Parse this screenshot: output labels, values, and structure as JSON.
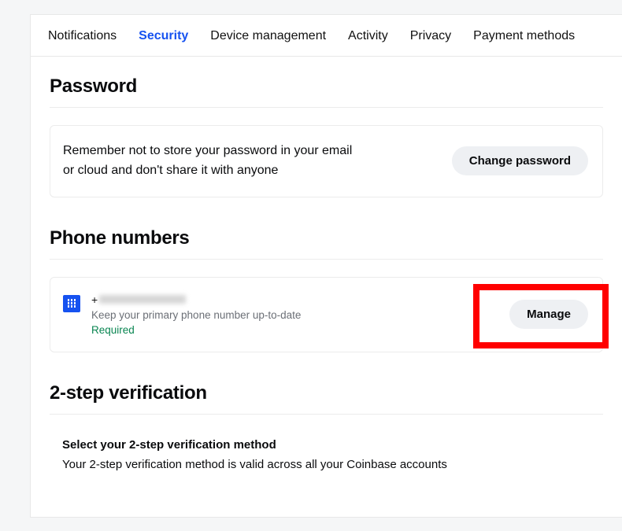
{
  "tabs": {
    "notifications": "Notifications",
    "security": "Security",
    "device_management": "Device management",
    "activity": "Activity",
    "privacy": "Privacy",
    "payment_methods": "Payment methods"
  },
  "password": {
    "title": "Password",
    "reminder": "Remember not to store your password in your email or cloud and don't share it with anyone",
    "change_button": "Change password"
  },
  "phone": {
    "title": "Phone numbers",
    "number_prefix": "+",
    "description": "Keep your primary phone number up-to-date",
    "required_label": "Required",
    "manage_button": "Manage"
  },
  "twostep": {
    "title": "2-step verification",
    "select_heading": "Select your 2-step verification method",
    "desc": "Your 2-step verification method is valid across all your Coinbase accounts"
  }
}
